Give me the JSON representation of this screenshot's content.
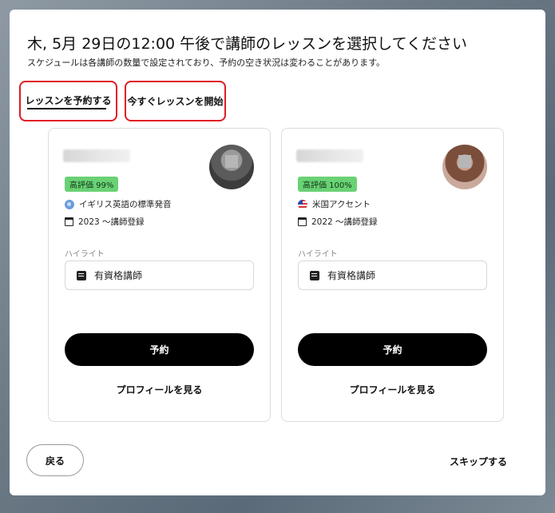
{
  "modal": {
    "title": "木, 5月 29日の12:00 午後で講師のレッスンを選択してください",
    "subtitle": "スケジュールは各講師の数量で設定されており、予約の空き状況は変わることがあります。"
  },
  "tabs": {
    "book_label": "レッスンを予約する",
    "start_now_label": "今すぐレッスンを開始"
  },
  "tutors": [
    {
      "badge": "高評価 99%",
      "accent": "イギリス英語の標準発音",
      "accent_icon": "globe-icon",
      "since": "2023 〜講師登録",
      "highlight_label": "ハイライト",
      "highlight": "有資格講師",
      "book_label": "予約",
      "profile_label": "プロフィールを見る"
    },
    {
      "badge": "高評価 100%",
      "accent": "米国アクセント",
      "accent_icon": "us-flag-icon",
      "since": "2022 〜講師登録",
      "highlight_label": "ハイライト",
      "highlight": "有資格講師",
      "book_label": "予約",
      "profile_label": "プロフィールを見る"
    }
  ],
  "footer": {
    "back_label": "戻る",
    "skip_label": "スキップする"
  },
  "colors": {
    "badge_bg": "#6ad175",
    "tab_highlight": "#e01b24",
    "primary_button": "#000000"
  }
}
